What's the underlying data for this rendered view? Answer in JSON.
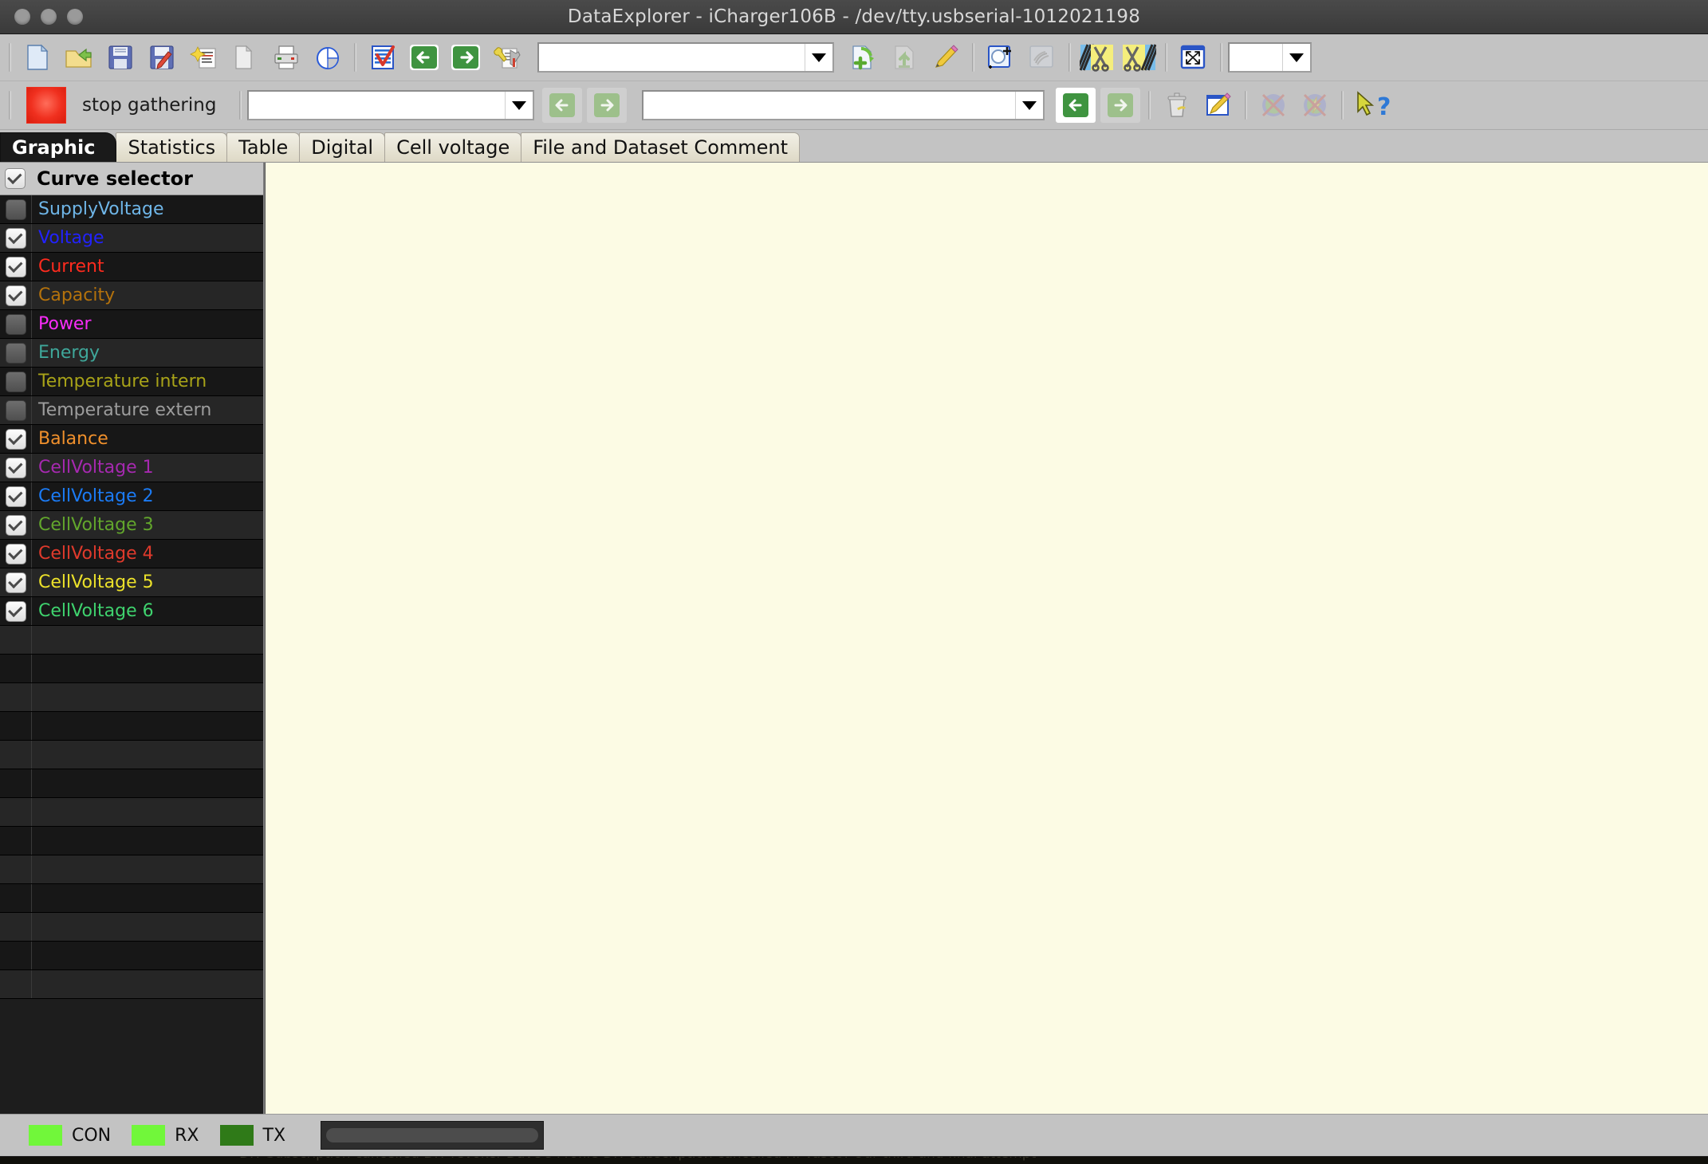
{
  "window": {
    "title": "DataExplorer  -  iCharger106B  -  /dev/tty.usbserial-1012021198",
    "traffic_lights": [
      "close",
      "minimize",
      "zoom"
    ]
  },
  "toolbar_primary": {
    "buttons": [
      {
        "name": "new-file-icon",
        "tip": "New",
        "enabled": true
      },
      {
        "name": "open-folder-icon",
        "tip": "Open",
        "enabled": true
      },
      {
        "name": "save-icon",
        "tip": "Save",
        "enabled": true
      },
      {
        "name": "save-as-icon",
        "tip": "Save as",
        "enabled": true
      },
      {
        "name": "import-settings-icon",
        "tip": "Import device settings",
        "enabled": true
      },
      {
        "name": "copy-icon",
        "tip": "Copy",
        "enabled": true
      },
      {
        "name": "print-icon",
        "tip": "Print",
        "enabled": true
      },
      {
        "name": "pie-chart-icon",
        "tip": "Statistics",
        "enabled": true
      },
      {
        "name": "device-select-icon",
        "tip": "Device selection",
        "enabled": true
      },
      {
        "name": "prev-device-icon",
        "tip": "Previous device",
        "enabled": true
      },
      {
        "name": "next-device-icon",
        "tip": "Next device",
        "enabled": true
      },
      {
        "name": "device-tools-icon",
        "tip": "Device tool box",
        "enabled": true
      },
      {
        "name": "add-record-icon",
        "tip": "Add record set",
        "enabled": true
      },
      {
        "name": "export-record-icon",
        "tip": "Export record set",
        "enabled": false
      },
      {
        "name": "edit-record-icon",
        "tip": "Edit record set",
        "enabled": true
      },
      {
        "name": "zoom-window-icon",
        "tip": "Zoom window",
        "enabled": true
      },
      {
        "name": "pan-icon",
        "tip": "Pan",
        "enabled": false
      },
      {
        "name": "cut-left-icon",
        "tip": "Cut left",
        "enabled": true
      },
      {
        "name": "cut-right-icon",
        "tip": "Cut right",
        "enabled": true
      },
      {
        "name": "fit-window-icon",
        "tip": "Fit to window",
        "enabled": true
      }
    ],
    "device_combo": {
      "value": "",
      "placeholder": ""
    },
    "channel_combo": {
      "value": "",
      "placeholder": ""
    }
  },
  "toolbar_secondary": {
    "gather_label": "stop gathering",
    "gather_state_color": "#ef2e1d",
    "object_combo": {
      "value": "",
      "placeholder": ""
    },
    "record_combo": {
      "value": "",
      "placeholder": ""
    },
    "buttons": [
      {
        "name": "prev-object-icon",
        "tip": "Previous object",
        "enabled": false
      },
      {
        "name": "next-object-icon",
        "tip": "Next object",
        "enabled": false
      },
      {
        "name": "prev-record-icon",
        "tip": "Previous record set",
        "enabled": true
      },
      {
        "name": "next-record-icon",
        "tip": "Next record set",
        "enabled": true
      },
      {
        "name": "delete-record-icon",
        "tip": "Delete record set",
        "enabled": true
      },
      {
        "name": "edit-comment-icon",
        "tip": "Edit comment",
        "enabled": true
      },
      {
        "name": "google-earth-off-icon",
        "tip": "Google Earth export disabled",
        "enabled": false
      },
      {
        "name": "google-earth-live-off-icon",
        "tip": "Google Earth live disabled",
        "enabled": false
      },
      {
        "name": "context-help-icon",
        "tip": "Context help",
        "enabled": true
      }
    ]
  },
  "tabs": [
    {
      "label": "Graphic",
      "active": true
    },
    {
      "label": "Statistics",
      "active": false
    },
    {
      "label": "Table",
      "active": false
    },
    {
      "label": "Digital",
      "active": false
    },
    {
      "label": "Cell voltage",
      "active": false
    },
    {
      "label": "File and Dataset Comment",
      "active": false
    }
  ],
  "curve_selector": {
    "header_label": "Curve selector",
    "header_checked": true,
    "items": [
      {
        "label": "SupplyVoltage",
        "checked": false,
        "color": "#6fb6e8"
      },
      {
        "label": "Voltage",
        "checked": true,
        "color": "#2222ff"
      },
      {
        "label": "Current",
        "checked": true,
        "color": "#ff2b1e"
      },
      {
        "label": "Capacity",
        "checked": true,
        "color": "#b4720c"
      },
      {
        "label": "Power",
        "checked": false,
        "color": "#f92cf9"
      },
      {
        "label": "Energy",
        "checked": false,
        "color": "#3fa79a"
      },
      {
        "label": "Temperature intern",
        "checked": false,
        "color": "#a8a318"
      },
      {
        "label": "Temperature extern",
        "checked": false,
        "color": "#9d9d9d"
      },
      {
        "label": "Balance",
        "checked": true,
        "color": "#f0902c"
      },
      {
        "label": "CellVoltage 1",
        "checked": true,
        "color": "#a629b0"
      },
      {
        "label": "CellVoltage 2",
        "checked": true,
        "color": "#1b7bf5"
      },
      {
        "label": "CellVoltage 3",
        "checked": true,
        "color": "#62a62c"
      },
      {
        "label": "CellVoltage 4",
        "checked": true,
        "color": "#df3a2c"
      },
      {
        "label": "CellVoltage 5",
        "checked": true,
        "color": "#ece12a"
      },
      {
        "label": "CellVoltage 6",
        "checked": true,
        "color": "#3fd36e"
      }
    ],
    "empty_row_count": 13
  },
  "graph": {
    "background_color": "#fcfbe4",
    "content": ""
  },
  "statusbar": {
    "indicators": [
      {
        "label": "CON",
        "color": "#71f73a"
      },
      {
        "label": "RX",
        "color": "#71f73a"
      },
      {
        "label": "TX",
        "color": "#2f7a18"
      }
    ],
    "progress_value": 0
  },
  "desktop_background": {
    "strip_text": "DIY      Subscription cancelled      DIY revoker Dave's Profile DIY subscription cancelled Hi Vasco!  Our third and final attempt"
  }
}
